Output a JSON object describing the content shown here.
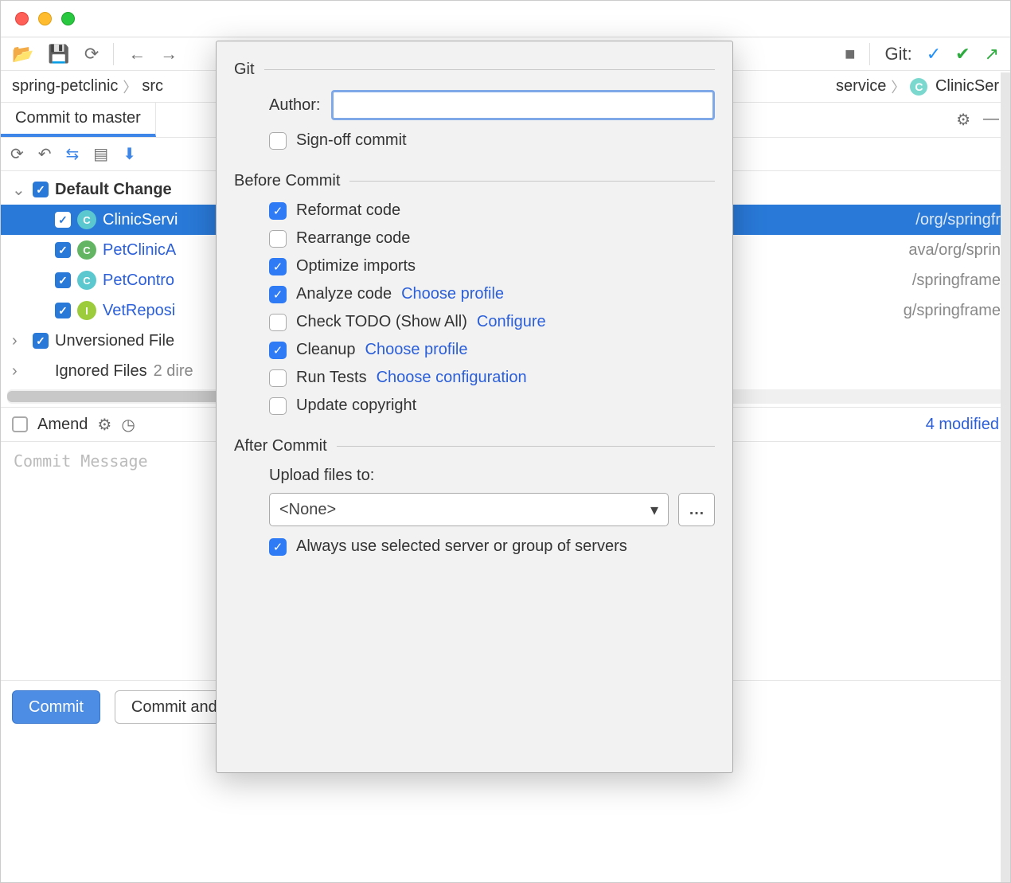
{
  "toolbar": {
    "git_label": "Git:"
  },
  "breadcrumb": {
    "root": "spring-petclinic",
    "src": "src",
    "service": "service",
    "file": "ClinicSer"
  },
  "tab": {
    "title": "Commit to master"
  },
  "changes": {
    "default_label": "Default Change",
    "files": [
      {
        "name": "ClinicServi",
        "path": "/org/springfr"
      },
      {
        "name": "PetClinicA",
        "path": "ava/org/sprin"
      },
      {
        "name": "PetContro",
        "path": "/springframe"
      },
      {
        "name": "VetReposi",
        "path": "g/springframe"
      }
    ],
    "unversioned_label": "Unversioned File",
    "ignored_label": "Ignored Files",
    "ignored_suffix": "2 dire"
  },
  "amend": {
    "label": "Amend",
    "modified": "4 modified"
  },
  "message": {
    "placeholder": "Commit Message"
  },
  "buttons": {
    "commit": "Commit",
    "commit_push": "Commit and Push…"
  },
  "popup": {
    "git_section": "Git",
    "author_label": "Author:",
    "signoff": "Sign-off commit",
    "before_section": "Before Commit",
    "reformat": "Reformat code",
    "rearrange": "Rearrange code",
    "optimize": "Optimize imports",
    "analyze": "Analyze code",
    "choose_profile": "Choose profile",
    "check_todo": "Check TODO (Show All)",
    "configure": "Configure",
    "cleanup": "Cleanup",
    "run_tests": "Run Tests",
    "choose_config": "Choose configuration",
    "update_copyright": "Update copyright",
    "after_section": "After Commit",
    "upload_label": "Upload files to:",
    "upload_value": "<None>",
    "always_use": "Always use selected server or group of servers"
  }
}
